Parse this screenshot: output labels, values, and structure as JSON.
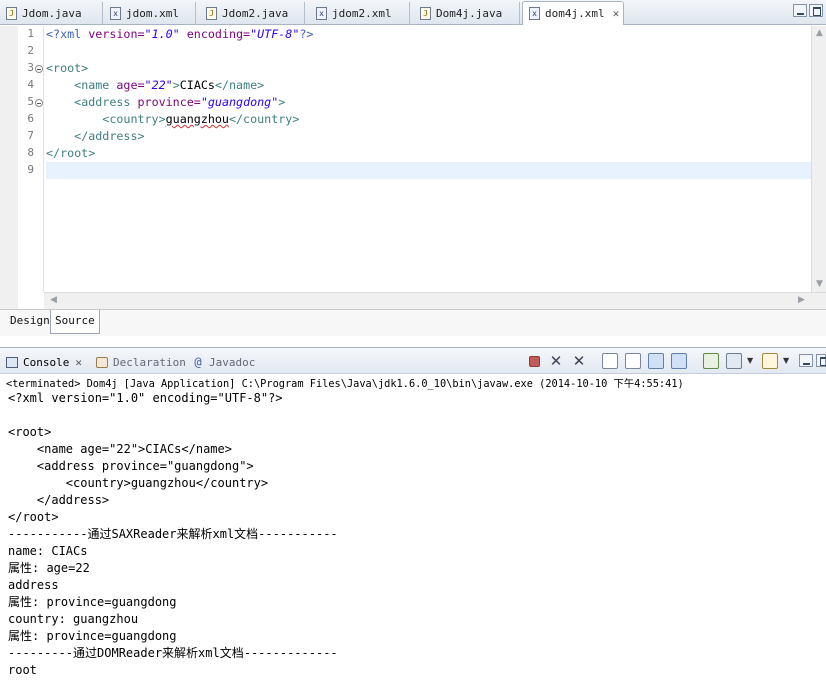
{
  "editor_tabs": [
    {
      "label": "Jdom.java",
      "icon": "java-file-icon"
    },
    {
      "label": "jdom.xml",
      "icon": "xml-file-icon"
    },
    {
      "label": "Jdom2.java",
      "icon": "java-file-icon"
    },
    {
      "label": "jdom2.xml",
      "icon": "xml-file-icon"
    },
    {
      "label": "Dom4j.java",
      "icon": "java-file-icon"
    },
    {
      "label": "dom4j.xml",
      "icon": "xml-file-icon",
      "active": true,
      "close": "✕"
    }
  ],
  "editor": {
    "line_numbers": [
      "1",
      "2",
      "3",
      "4",
      "5",
      "6",
      "7",
      "8",
      "9"
    ],
    "l1_open": "<?xml ",
    "l1_attr1": "version=",
    "l1_val1": "\"1.0\"",
    "l1_attr2": " encoding=",
    "l1_val2": "\"UTF-8\"",
    "l1_close": "?>",
    "l3_tag": "<root>",
    "l4_indent": "    ",
    "l4_tag": "<name ",
    "l4_attr": "age=",
    "l4_val": "\"22\"",
    "l4_gt": ">",
    "l4_text": "CIACs",
    "l4_end": "</name>",
    "l5_indent": "    ",
    "l5_tag": "<address ",
    "l5_attr": "province=",
    "l5_val": "\"guangdong\"",
    "l5_gt": ">",
    "l6_indent": "        ",
    "l6_tag": "<country>",
    "l6_text": "guangzhou",
    "l6_end": "</country>",
    "l7_indent": "    ",
    "l7_tag": "</address>",
    "l8_tag": "</root>"
  },
  "subtabs": {
    "design": "Design",
    "source": "Source"
  },
  "console_view": {
    "tabs": [
      {
        "label": "Console",
        "close": "✕"
      },
      {
        "label": "Declaration"
      },
      {
        "label": "Javadoc"
      }
    ],
    "status": "<terminated> Dom4j [Java Application] C:\\Program Files\\Java\\jdk1.6.0_10\\bin\\javaw.exe (2014-10-10 下午4:55:41)",
    "output": [
      "<?xml version=\"1.0\" encoding=\"UTF-8\"?>",
      "",
      "<root>",
      "    <name age=\"22\">CIACs</name>",
      "    <address province=\"guangdong\">",
      "        <country>guangzhou</country>",
      "    </address>",
      "</root>",
      "-----------通过SAXReader来解析xml文档-----------",
      "name: CIACs",
      "属性: age=22",
      "address",
      "属性: province=guangdong",
      "country: guangzhou",
      "属性: province=guangdong",
      "---------通过DOMReader来解析xml文档-------------",
      "root"
    ]
  },
  "colors": {
    "xml_tag": "#3f7f7f",
    "xml_attr": "#7f007f",
    "xml_value": "#2a00ff",
    "current_line": "#e8f2fe"
  }
}
